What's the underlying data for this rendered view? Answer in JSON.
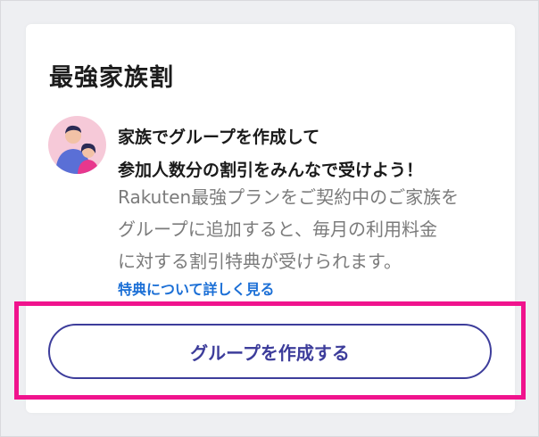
{
  "card": {
    "title": "最強家族割",
    "headline_line1": "家族でグループを作成して",
    "headline_line2": "参加人数分の割引をみんなで受けよう！",
    "body_line1": "Rakuten最強プランをご契約中のご家族を",
    "body_line2": "グループに追加すると、毎月の利用料金",
    "body_line3": "に対する割引特典が受けられます。",
    "link_label": "特典について詳しく見る",
    "button_label": "グループを作成する"
  },
  "colors": {
    "accent": "#3d3d9b",
    "link": "#1b6fd6",
    "highlight": "#f0138d",
    "avatar_bg": "#f6c9d8"
  },
  "icons": {
    "avatar": "family-illustration-icon"
  }
}
